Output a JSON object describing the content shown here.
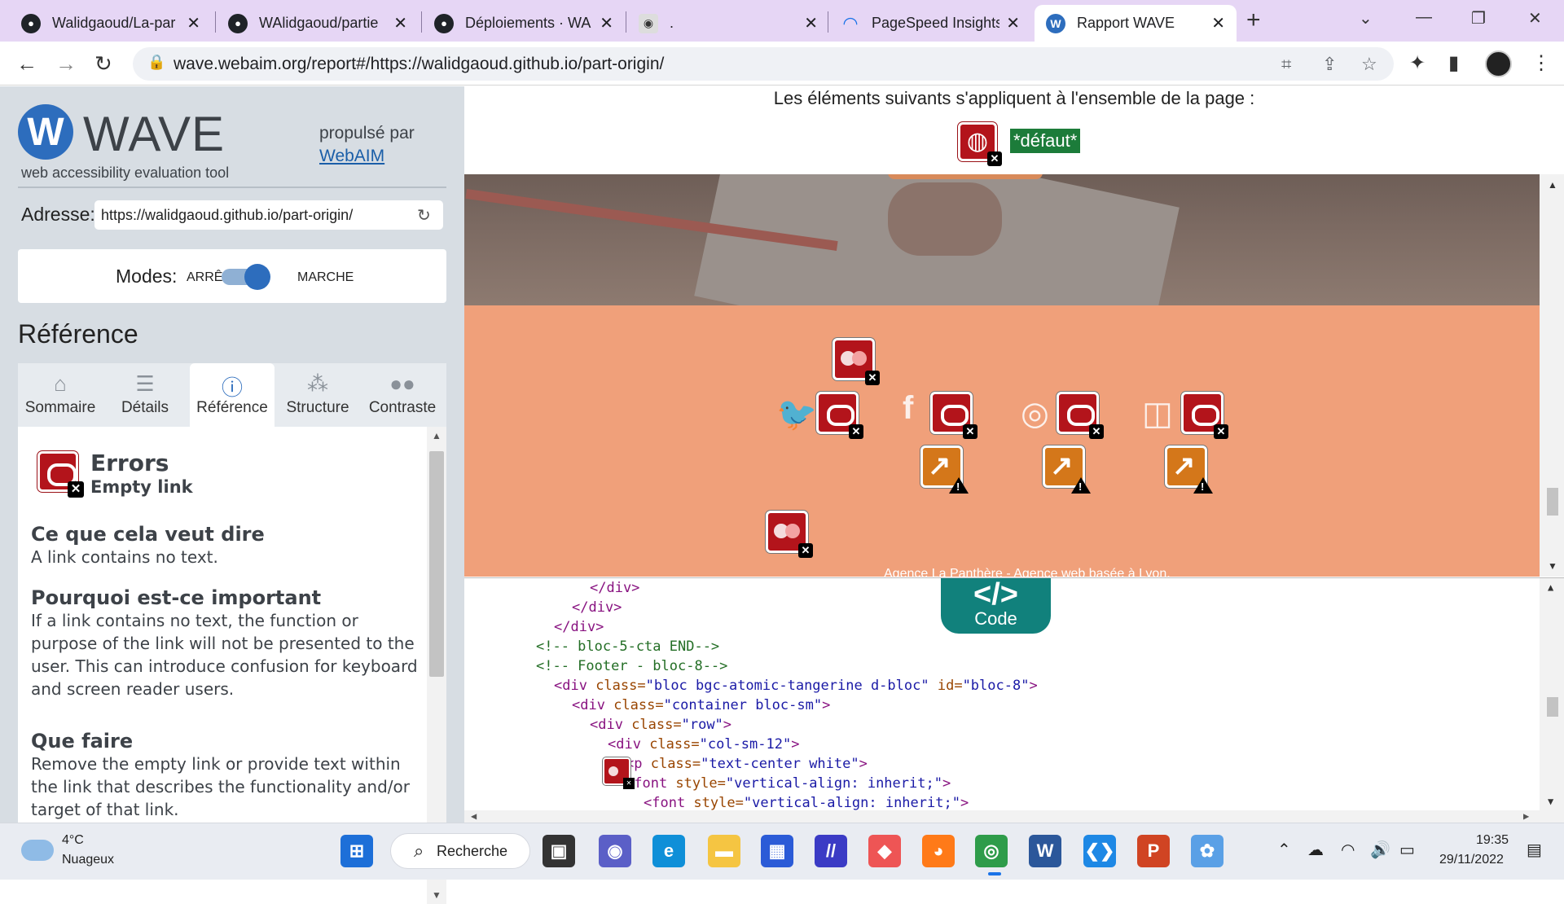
{
  "browser": {
    "tabs": [
      {
        "title": "Walidgaoud/La-par",
        "icon": "github-icon"
      },
      {
        "title": "WAlidgaoud/partie",
        "icon": "github-icon"
      },
      {
        "title": "Déploiements · WA",
        "icon": "github-icon"
      },
      {
        "title": ".",
        "icon": "panther-icon"
      },
      {
        "title": "PageSpeed Insights",
        "icon": "pagespeed-icon"
      },
      {
        "title": "Rapport WAVE",
        "icon": "wave-icon"
      }
    ],
    "url": "wave.webaim.org/report#/https://walidgaoud.github.io/part-origin/"
  },
  "wave": {
    "logo_text": "WAVE",
    "logo_letter": "W",
    "subtitle": "web accessibility evaluation tool",
    "powered_by": "propulsé par",
    "powered_link": "WebAIM",
    "address_label": "Adresse:",
    "address_value": "https://walidgaoud.github.io/part-origin/",
    "modes_label": "Modes:",
    "mode_off": "ARRÊT",
    "mode_on": "MARCHE",
    "reference_title": "Référence",
    "tabs": [
      "Sommaire",
      "Détails",
      "Référence",
      "Structure",
      "Contraste"
    ],
    "active_tab": "Référence",
    "panel": {
      "category": "Errors",
      "item": "Empty link",
      "sections": [
        {
          "heading": "Ce que cela veut dire",
          "text": "A link contains no text."
        },
        {
          "heading": "Pourquoi est-ce important",
          "text": "If a link contains no text, the function or purpose of the link will not be presented to the user. This can introduce confusion for keyboard and screen reader users."
        },
        {
          "heading": "Que faire",
          "text": "Remove the empty link or provide text within the link that describes the functionality and/or target of that link."
        }
      ]
    }
  },
  "report": {
    "page_note": "Les éléments suivants s'appliquent à l'ensemble de la page :",
    "default_tag": "*défaut*",
    "footer_text": "Agence La Panthère - Agence web basée à Lyon.",
    "code_badge": {
      "symbol": "</>",
      "label": "Code"
    },
    "code_lines": [
      {
        "indent": 7,
        "parts": [
          {
            "t": "tag",
            "v": "</div>"
          }
        ]
      },
      {
        "indent": 6,
        "parts": [
          {
            "t": "tag",
            "v": "</div>"
          }
        ]
      },
      {
        "indent": 5,
        "parts": [
          {
            "t": "tag",
            "v": "</div>"
          }
        ]
      },
      {
        "indent": 4,
        "parts": [
          {
            "t": "com",
            "v": "<!-- bloc-5-cta END-->"
          }
        ]
      },
      {
        "indent": 4,
        "parts": [
          {
            "t": "com",
            "v": "<!-- Footer - bloc-8-->"
          }
        ]
      },
      {
        "indent": 5,
        "parts": [
          {
            "t": "tag",
            "v": "<div "
          },
          {
            "t": "attr",
            "v": "class="
          },
          {
            "t": "val",
            "v": "\"bloc bgc-atomic-tangerine d-bloc\""
          },
          {
            "t": "attr",
            "v": " id="
          },
          {
            "t": "val",
            "v": "\"bloc-8\""
          },
          {
            "t": "tag",
            "v": ">"
          }
        ]
      },
      {
        "indent": 6,
        "parts": [
          {
            "t": "tag",
            "v": "<div "
          },
          {
            "t": "attr",
            "v": "class="
          },
          {
            "t": "val",
            "v": "\"container bloc-sm\""
          },
          {
            "t": "tag",
            "v": ">"
          }
        ]
      },
      {
        "indent": 7,
        "parts": [
          {
            "t": "tag",
            "v": "<div "
          },
          {
            "t": "attr",
            "v": "class="
          },
          {
            "t": "val",
            "v": "\"row\""
          },
          {
            "t": "tag",
            "v": ">"
          }
        ]
      },
      {
        "indent": 8,
        "parts": [
          {
            "t": "tag",
            "v": "<div "
          },
          {
            "t": "attr",
            "v": "class="
          },
          {
            "t": "val",
            "v": "\"col-sm-12\""
          },
          {
            "t": "tag",
            "v": ">"
          }
        ]
      },
      {
        "indent": 9,
        "parts": [
          {
            "t": "tag",
            "v": "<p "
          },
          {
            "t": "attr",
            "v": "class="
          },
          {
            "t": "val",
            "v": "\"text-center white\""
          },
          {
            "t": "tag",
            "v": ">"
          }
        ]
      },
      {
        "indent": 9,
        "parts": [
          {
            "t": "tag",
            "v": "<font "
          },
          {
            "t": "attr",
            "v": "style="
          },
          {
            "t": "val",
            "v": "\"vertical-align: inherit;\""
          },
          {
            "t": "tag",
            "v": ">"
          }
        ]
      },
      {
        "indent": 10,
        "parts": [
          {
            "t": "tag",
            "v": "<font "
          },
          {
            "t": "attr",
            "v": "style="
          },
          {
            "t": "val",
            "v": "\"vertical-align: inherit;\""
          },
          {
            "t": "tag",
            "v": ">"
          }
        ]
      }
    ]
  },
  "taskbar": {
    "weather_temp": "4°C",
    "weather_desc": "Nuageux",
    "search_label": "Recherche",
    "time": "19:35",
    "date": "29/11/2022"
  },
  "colors": {
    "wave_blue": "#2d6dbd",
    "error_red": "#b3141b",
    "alert_orange": "#d4771a",
    "footer_orange": "#f0a07a",
    "code_teal": "#11817c"
  }
}
